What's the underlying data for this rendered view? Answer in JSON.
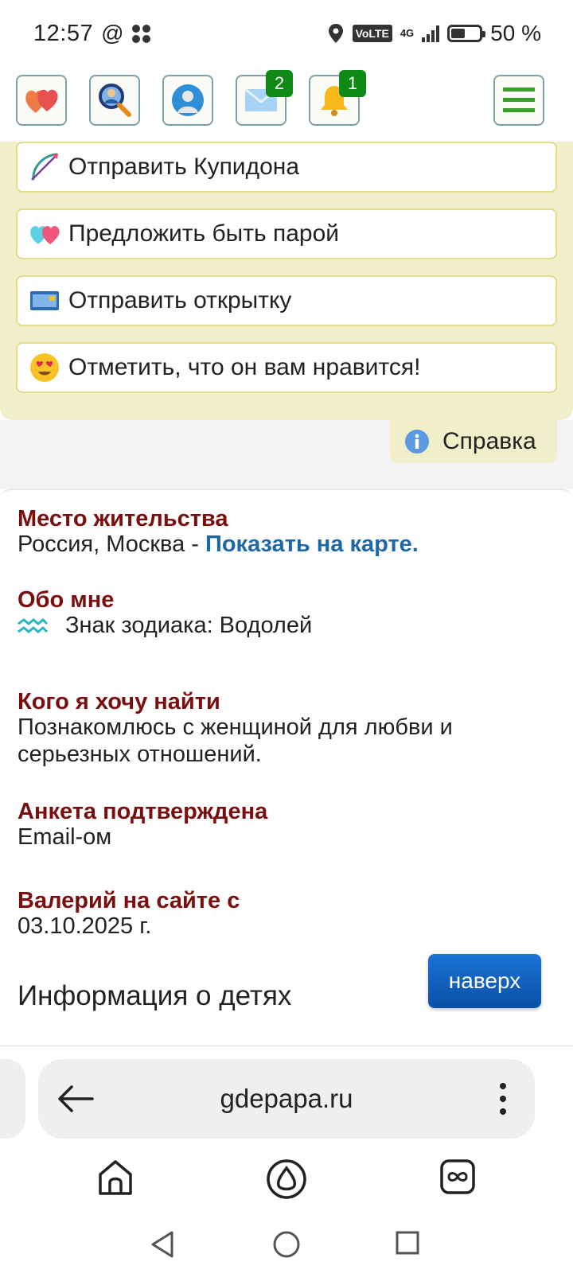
{
  "status_bar": {
    "time": "12:57",
    "at_symbol": "@",
    "volte": "VoLTE",
    "network": "4G",
    "battery_label": "50 %",
    "battery_level": 0.5
  },
  "top_nav": {
    "items": [
      {
        "name": "hearts",
        "icon": "hearts-icon"
      },
      {
        "name": "search",
        "icon": "search-person-icon"
      },
      {
        "name": "profile",
        "icon": "profile-icon"
      },
      {
        "name": "messages",
        "icon": "envelope-icon",
        "badge": "2"
      },
      {
        "name": "notifications",
        "icon": "bell-icon",
        "badge": "1"
      },
      {
        "name": "menu",
        "icon": "hamburger-icon"
      }
    ],
    "badge_color": "#0f8a16"
  },
  "actions": {
    "items": [
      {
        "label": "Отправить Купидона",
        "icon": "cupid-bow-icon"
      },
      {
        "label": "Предложить быть парой",
        "icon": "two-hearts-icon"
      },
      {
        "label": "Отправить открытку",
        "icon": "postcard-icon"
      },
      {
        "label": "Отметить, что он вам нравится!",
        "icon": "heart-eyes-emoji-icon"
      }
    ],
    "help_label": "Справка",
    "bg_color": "#f1efc9"
  },
  "profile": {
    "residence": {
      "heading": "Место жительства",
      "value": "Россия, Москва - ",
      "map_link": "Показать на карте."
    },
    "about": {
      "heading": "Обо мне",
      "zodiac": "Знак зодиака: Водолей"
    },
    "looking_for": {
      "heading": "Кого я хочу найти",
      "line1": "Познакомлюсь с женщиной для любви и",
      "line2": "серьезных отношений."
    },
    "verified": {
      "heading": "Анкета подтверждена",
      "value": "Email-ом"
    },
    "member_since": {
      "heading": "Валерий на сайте с",
      "value": "03.10.2025 г."
    },
    "children_title": "Информация о детях",
    "heading_color": "#7a0d0d",
    "link_color": "#1e68a8"
  },
  "to_top_button": "наверх",
  "browser": {
    "url": "gdepapa.ru"
  }
}
